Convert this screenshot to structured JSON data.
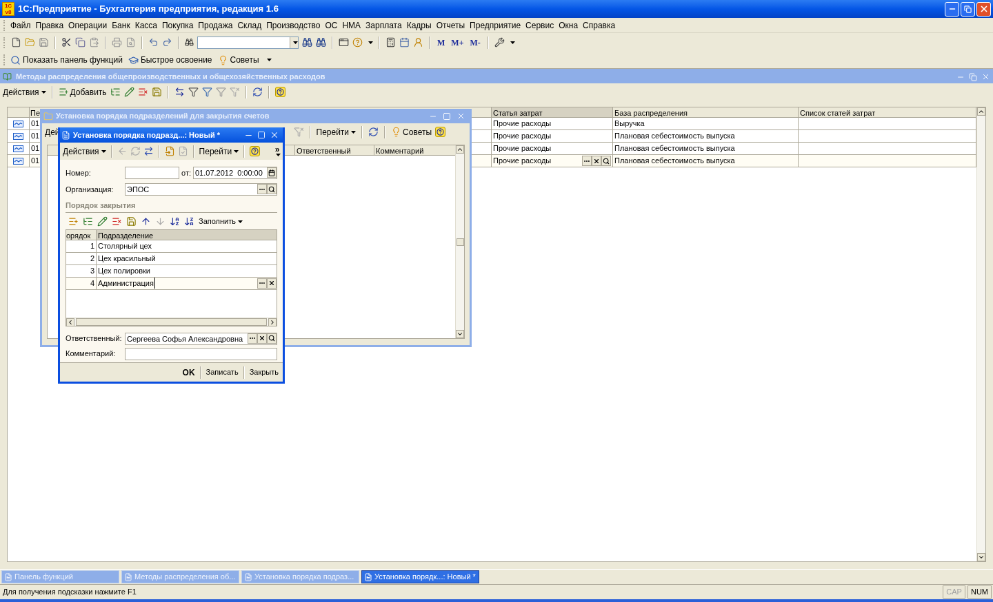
{
  "window": {
    "title": "1С:Предприятие - Бухгалтерия предприятия, редакция 1.6",
    "logo": [
      "1С",
      "v8"
    ]
  },
  "menu": [
    "Файл",
    "Правка",
    "Операции",
    "Банк",
    "Касса",
    "Покупка",
    "Продажа",
    "Склад",
    "Производство",
    "ОС",
    "НМА",
    "Зарплата",
    "Кадры",
    "Отчеты",
    "Предприятие",
    "Сервис",
    "Окна",
    "Справка"
  ],
  "toolbar": {
    "memory_buttons": [
      "M",
      "M+",
      "M-"
    ]
  },
  "quick_bar": [
    "Показать панель функций",
    "Быстрое освоение",
    "Советы"
  ],
  "list_window": {
    "title": "Методы распределения общепроизводственных и общехозяйственных расходов",
    "actions": "Действия",
    "add": "Добавить",
    "columns": [
      "Пе",
      "Статья затрат",
      "База распределения",
      "Список статей затрат"
    ],
    "rows": [
      {
        "date": "01",
        "cost_item": "Прочие расходы",
        "base": "Выручка",
        "editing": false
      },
      {
        "date": "01",
        "cost_item": "Прочие расходы",
        "base": "Плановая себестоимость выпуска",
        "editing": false
      },
      {
        "date": "01",
        "cost_item": "Прочие расходы",
        "base": "Плановая себестоимость выпуска",
        "editing": false
      },
      {
        "date": "01",
        "cost_item": "Прочие расходы",
        "base": "Плановая себестоимость выпуска",
        "editing": true
      }
    ]
  },
  "accounts_window": {
    "title": "Установка порядка подразделений для закрытия счетов",
    "actions": "Дей",
    "goto": "Перейти",
    "tips": "Советы",
    "columns": [
      "Ответственный",
      "Комментарий"
    ]
  },
  "dialog": {
    "title": "Установка порядка подразд...: Новый *",
    "actions": "Действия",
    "goto": "Перейти",
    "more": "»",
    "number_label": "Номер:",
    "date_label": "от:",
    "date": "01.07.2012  0:00:00",
    "organization_label": "Организация:",
    "organization": "ЭПОС",
    "section": "Порядок закрытия",
    "fill": "Заполнить",
    "columns": [
      "орядок",
      "Подразделение"
    ],
    "rows": [
      {
        "order": "1",
        "department": "Столярный цех",
        "editing": false
      },
      {
        "order": "2",
        "department": "Цех красильный",
        "editing": false
      },
      {
        "order": "3",
        "department": "Цех полировки",
        "editing": false
      },
      {
        "order": "4",
        "department": "Администрация",
        "editing": true
      }
    ],
    "responsible_label": "Ответственный:",
    "responsible": "Сергеева Софья Александровна",
    "comment_label": "Комментарий:",
    "buttons": [
      "OK",
      "Записать",
      "Закрыть"
    ]
  },
  "taskbar": [
    {
      "label": "Панель функций",
      "selected": false
    },
    {
      "label": "Методы распределения об...",
      "selected": false
    },
    {
      "label": "Установка порядка подраз...",
      "selected": false
    },
    {
      "label": "Установка порядк...: Новый *",
      "selected": true
    }
  ],
  "status_bar": {
    "hint": "Для получения подсказки нажмите F1",
    "indicators": [
      {
        "label": "CAP",
        "on": false
      },
      {
        "label": "NUM",
        "on": true
      }
    ]
  }
}
